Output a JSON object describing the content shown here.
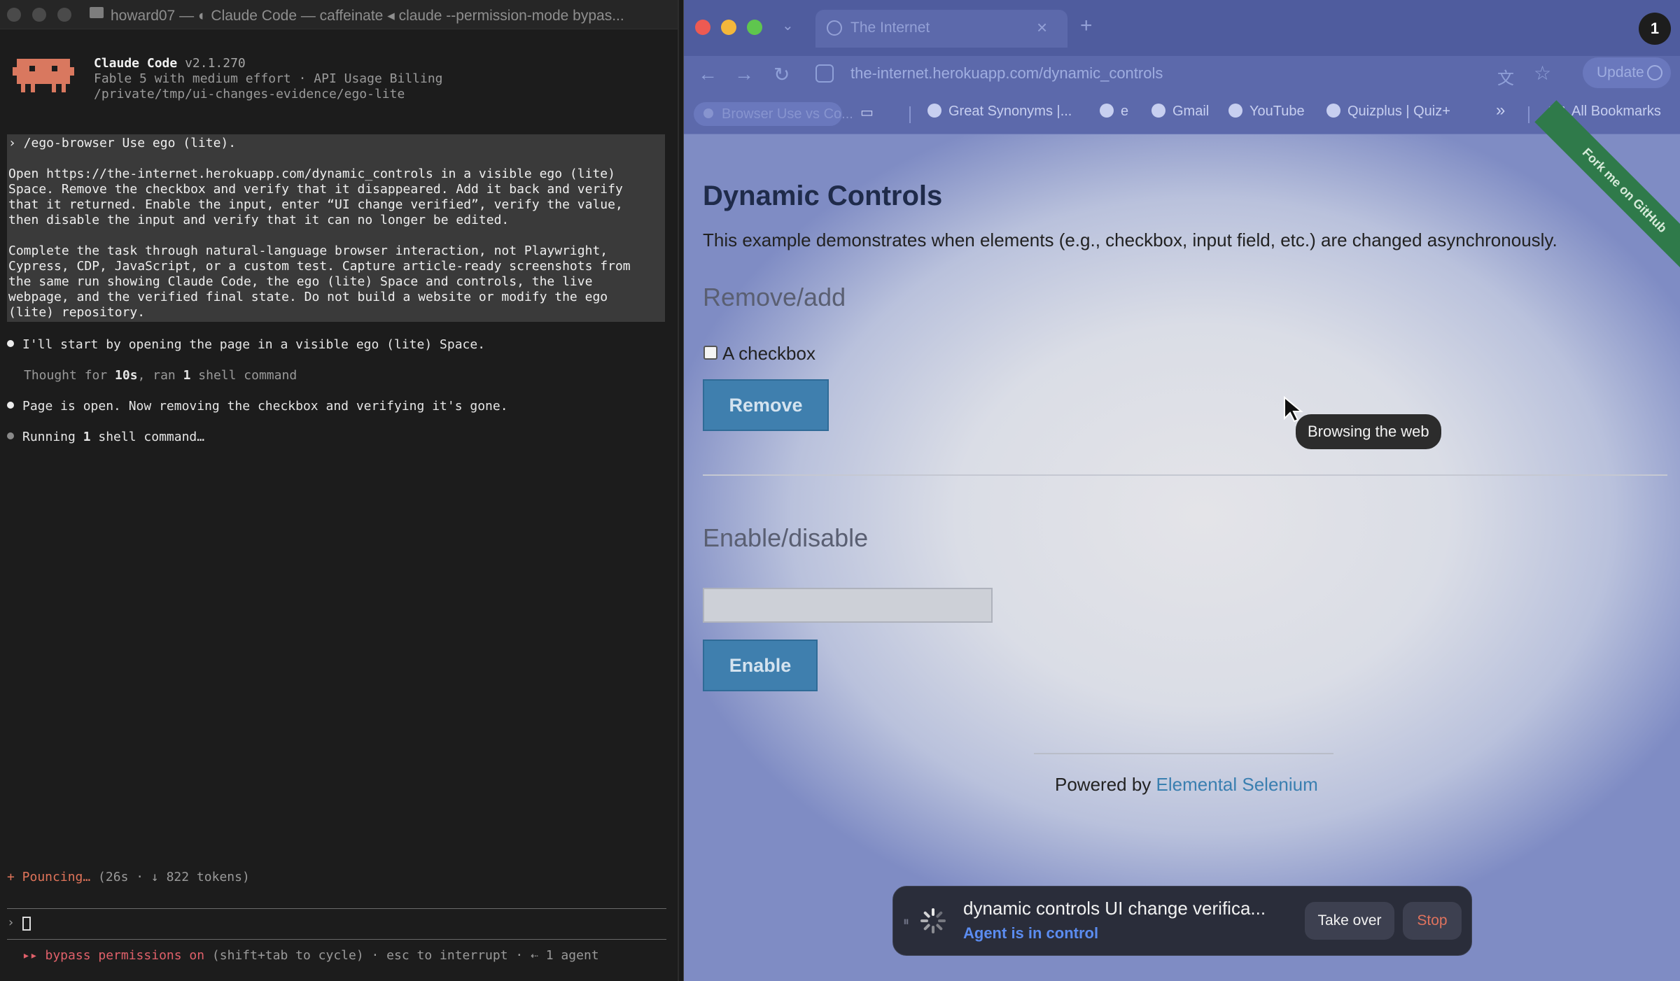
{
  "terminal": {
    "window_title": "howard07 — ◐ Claude Code — caffeinate ◂ claude --permission-mode bypas...",
    "app_name": "Claude Code",
    "version": "v2.1.270",
    "model_line": "Fable 5 with medium effort · API Usage Billing",
    "path_line": "/private/tmp/ui-changes-evidence/ego-lite",
    "prompt_lines": [
      "› /ego-browser Use ego (lite).",
      "",
      "Open https://the-internet.herokuapp.com/dynamic_controls in a visible ego (lite)",
      "Space. Remove the checkbox and verify that it disappeared. Add it back and verify",
      "that it returned. Enable the input, enter “UI change verified”, verify the value,",
      "then disable the input and verify that it can no longer be edited.",
      "",
      "Complete the task through natural-language browser interaction, not Playwright,",
      "Cypress, CDP, JavaScript, or a custom test. Capture article-ready screenshots from",
      "the same run showing Claude Code, the ego (lite) Space and controls, the live",
      "webpage, and the verified final state. Do not build a website or modify the ego",
      "(lite) repository."
    ],
    "messages": {
      "m1": "I'll start by opening the page in a visible ego (lite) Space.",
      "m2_pre": "Thought for ",
      "m2_time": "10s",
      "m2_mid": ", ran ",
      "m2_count": "1",
      "m2_post": " shell command",
      "m3": "Page is open. Now removing the checkbox and verifying it's gone.",
      "m4_pre": "Running ",
      "m4_count": "1",
      "m4_post": " shell command…"
    },
    "status": {
      "spinner": "+ Pouncing…",
      "detail": " (26s · ↓ 822 tokens)"
    },
    "input_caret": "›",
    "permissions": {
      "marker": "▸▸ bypass permissions on",
      "rest": " (shift+tab to cycle) · esc to interrupt · ⇠ 1 agent"
    }
  },
  "browser": {
    "tab_title": "The Internet",
    "tab_close": "×",
    "new_tab": "+",
    "profile_badge": "1",
    "url": "the-internet.herokuapp.com/dynamic_controls",
    "update_label": "Update",
    "bookmarks": [
      "Browser Use vs Co...",
      "Great Synonyms |...",
      "e",
      "Gmail",
      "YouTube",
      "Quizplus | Quiz+"
    ],
    "bookmarks_more": "»",
    "all_bookmarks": "All Bookmarks",
    "nav_icons": [
      "back-arrow-icon",
      "forward-arrow-icon",
      "reload-icon",
      "site-settings-icon"
    ]
  },
  "page": {
    "ribbon": "Fork me on GitHub",
    "heading": "Dynamic Controls",
    "description": "This example demonstrates when elements (e.g., checkbox, input field, etc.) are changed asynchronously.",
    "remove_add_heading": "Remove/add",
    "checkbox_label": "A checkbox",
    "checkbox_checked": false,
    "remove_button": "Remove",
    "enable_disable_heading": "Enable/disable",
    "input_value": "",
    "input_disabled": true,
    "enable_button": "Enable",
    "footer_prefix": "Powered by ",
    "footer_link": "Elemental Selenium"
  },
  "overlay": {
    "tooltip": "Browsing the web",
    "agent_title": "dynamic controls UI change verifica...",
    "agent_status": "Agent is in control",
    "take_over": "Take over",
    "stop": "Stop"
  },
  "colors": {
    "terminal_bg": "#1c1c1c",
    "claude_orange": "#d9785f",
    "browser_chrome": "#5c69ab",
    "button_blue": "#3f7fae",
    "ribbon_green": "#2f7a4a",
    "agent_blue": "#5b8cf0",
    "stop_red": "#e0735e"
  }
}
